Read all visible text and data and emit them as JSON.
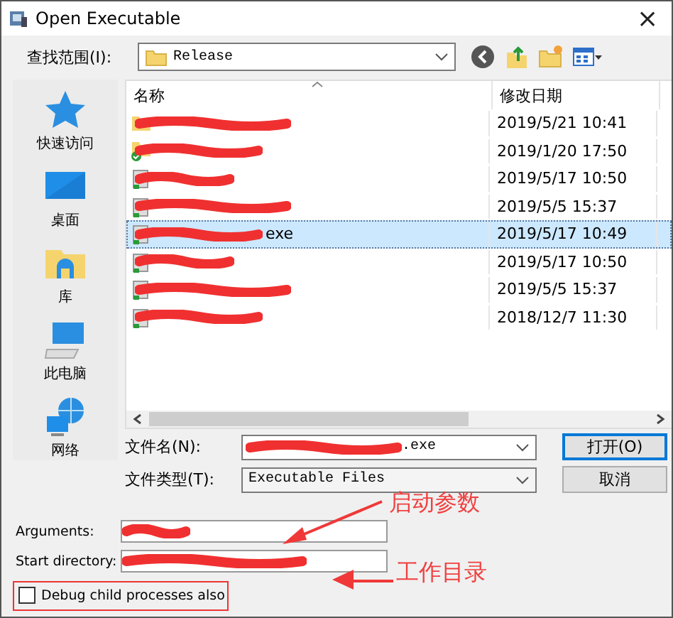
{
  "window": {
    "title": "Open Executable",
    "close": "×"
  },
  "look_in": {
    "label": "查找范围(I):",
    "value": "Release"
  },
  "sidebar": {
    "items": [
      {
        "label": "快速访问",
        "kind": "star"
      },
      {
        "label": "桌面",
        "kind": "desktop"
      },
      {
        "label": "库",
        "kind": "library"
      },
      {
        "label": "此电脑",
        "kind": "computer"
      },
      {
        "label": "网络",
        "kind": "network"
      }
    ]
  },
  "table": {
    "columns": [
      "名称",
      "修改日期"
    ],
    "rows": [
      {
        "kind": "folder",
        "redacted": true,
        "modified": "2019/5/21 10:41",
        "selected": false
      },
      {
        "kind": "folder-check",
        "redacted": true,
        "modified": "2019/1/20 17:50",
        "selected": false
      },
      {
        "kind": "file",
        "redacted": true,
        "modified": "2019/5/17 10:50",
        "selected": false
      },
      {
        "kind": "file",
        "redacted": true,
        "modified": "2019/5/5 15:37",
        "selected": false
      },
      {
        "kind": "file",
        "redacted": true,
        "name": "exe",
        "modified": "2019/5/17 10:49",
        "selected": true
      },
      {
        "kind": "file",
        "redacted": true,
        "modified": "2019/5/17 10:50",
        "selected": false
      },
      {
        "kind": "file",
        "redacted": true,
        "modified": "2019/5/5 15:37",
        "selected": false
      },
      {
        "kind": "file",
        "redacted": true,
        "modified": "2018/12/7 11:30",
        "selected": false
      }
    ]
  },
  "file_name": {
    "label": "文件名(N):",
    "value": ".exe",
    "redacted": true
  },
  "file_type": {
    "label": "文件类型(T):",
    "value": "Executable Files"
  },
  "buttons": [
    "打开(O)",
    "取消"
  ],
  "arguments": {
    "label": "Arguments:",
    "redacted": true
  },
  "start_directory": {
    "label": "Start directory:",
    "redacted": true
  },
  "debug_child": {
    "label": "Debug child processes also",
    "checked": false,
    "highlighted": true
  },
  "annotations": [
    "启动参数",
    "工作目录"
  ]
}
